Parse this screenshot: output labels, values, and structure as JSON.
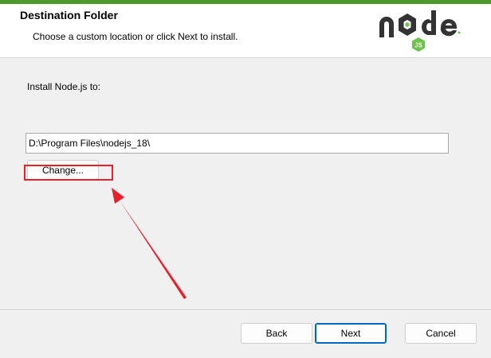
{
  "colors": {
    "accent_bar": "#4e9a2f",
    "node_dark": "#333333",
    "node_green": "#6cc24a",
    "annotation_red": "#e8202b",
    "primary_button_border": "#0067c0"
  },
  "header": {
    "title": "Destination Folder",
    "subtitle": "Choose a custom location or click Next to install.",
    "logo_icon": "nodejs-logo"
  },
  "main": {
    "install_label": "Install Node.js to:",
    "path_value": "D:\\Program Files\\nodejs_18\\",
    "change_label": "Change..."
  },
  "annotation": {
    "arrow_icon": "red-arrow-icon",
    "box": "red-highlight-box"
  },
  "footer": {
    "back_label": "Back",
    "next_label": "Next",
    "cancel_label": "Cancel"
  }
}
